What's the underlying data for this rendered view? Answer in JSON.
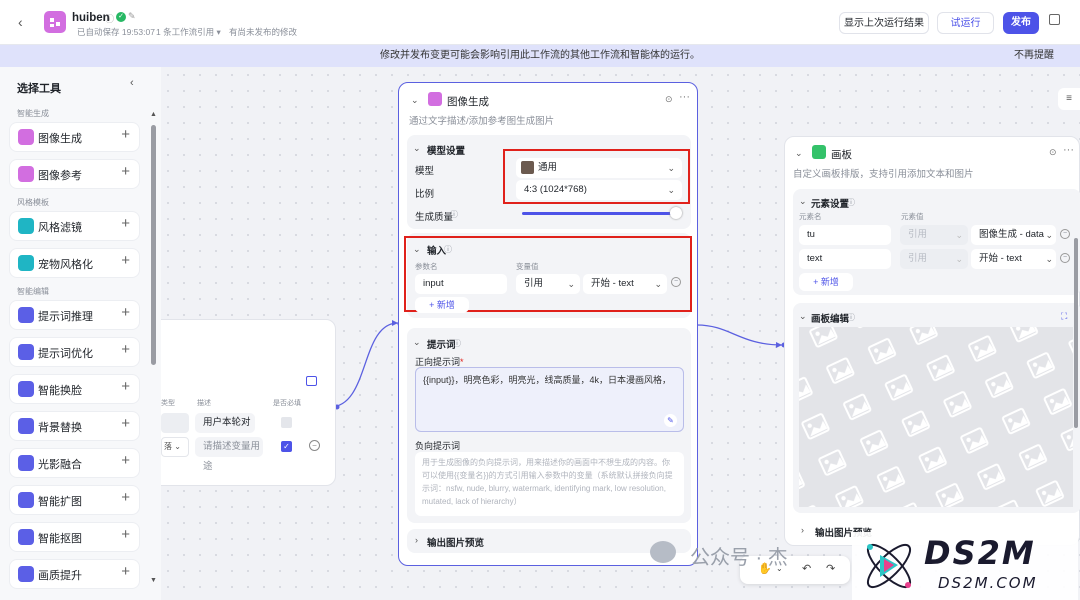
{
  "header": {
    "app_name": "huiben",
    "autosave": "已自动保存 19:53:07",
    "workflow_ref": "1 条工作流引用",
    "unpublished": "有尚未发布的修改",
    "show_last_run": "显示上次运行结果",
    "trial_run": "试运行",
    "publish": "发布"
  },
  "notice": {
    "text": "修改并发布变更可能会影响引用此工作流的其他工作流和智能体的运行。",
    "dismiss": "不再提醒"
  },
  "sidebar": {
    "title": "选择工具",
    "groups": [
      {
        "label": "智能生成",
        "items": [
          {
            "label": "图像生成"
          },
          {
            "label": "图像参考"
          }
        ]
      },
      {
        "label": "风格模板",
        "items": [
          {
            "label": "风格滤镜"
          },
          {
            "label": "宠物风格化"
          }
        ]
      },
      {
        "label": "智能编辑",
        "items": [
          {
            "label": "提示词推理"
          },
          {
            "label": "提示词优化"
          },
          {
            "label": "智能换脸"
          },
          {
            "label": "背景替换"
          },
          {
            "label": "光影融合"
          },
          {
            "label": "智能扩图"
          },
          {
            "label": "智能抠图"
          },
          {
            "label": "画质提升"
          }
        ]
      }
    ]
  },
  "start_node": {
    "col_type": "类型",
    "col_desc": "描述",
    "col_required": "是否必填",
    "row1_desc": "用户本轮对",
    "row2_desc_placeholder": "请描述变量用途"
  },
  "image_node": {
    "title": "图像生成",
    "desc": "通过文字描述/添加参考图生成图片",
    "model_section": {
      "title": "模型设置",
      "model_label": "模型",
      "model_value": "通用",
      "ratio_label": "比例",
      "ratio_value": "4:3 (1024*768)",
      "quality_label": "生成质量"
    },
    "input_section": {
      "title": "输入",
      "col_name": "参数名",
      "col_value": "变量值",
      "param_name": "input",
      "param_mode": "引用",
      "param_ref": "开始 - text",
      "add_label": "+ 新增"
    },
    "prompt_section": {
      "title": "提示词",
      "positive_label": "正向提示词",
      "positive_value": "{{input}}，明亮色彩，明亮光，线高质量，4k，日本漫画风格，",
      "negative_label": "负向提示词",
      "negative_placeholder": "用于生成图像的负向提示词，用来描述你的画面中不想生成的内容。你可以使用{{变量名}}的方式引用输入参数中的变量（系统默认拼接负向提示词：nsfw, nude, blurry, watermark, identifying mark, low resolution, mutated, lack of hierarchy）"
    },
    "output_label": "输出图片预览"
  },
  "canvas_node": {
    "title": "画板",
    "desc": "自定义画板排版，支持引用添加文本和图片",
    "element_section": {
      "title": "元素设置",
      "col_name": "元素名",
      "col_value": "元素值",
      "rows": [
        {
          "name": "tu",
          "mode": "引用",
          "ref": "图像生成 - data"
        },
        {
          "name": "text",
          "mode": "引用",
          "ref": "开始 - text"
        }
      ],
      "add_label": "+ 新增"
    },
    "edit_section": {
      "title": "画板编辑"
    },
    "output_label": "输出图片预览"
  },
  "watermark": {
    "text": "公众号 · 杰",
    "logo_text": "DS2M",
    "logo_url": "DS2M.COM"
  },
  "colors": {
    "accent": "#4d53e8",
    "highlight": "#e0211b",
    "node_icon_image": "#d26ee0",
    "node_icon_canvas": "#34c26a"
  }
}
